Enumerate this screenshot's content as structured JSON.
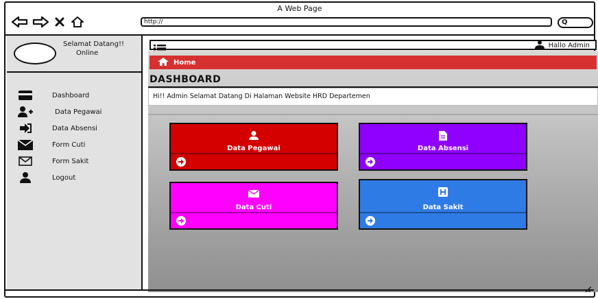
{
  "window": {
    "title": "A Web Page",
    "url": "http://",
    "search_label": "Q"
  },
  "sidebar": {
    "welcome": "Selamat Datang!!",
    "status": "Online",
    "menu": [
      {
        "label": "Dashboard",
        "icon": "credit-card-icon"
      },
      {
        "label": "Data Pegawai",
        "icon": "user-plus-icon"
      },
      {
        "label": "Data Absensi",
        "icon": "sign-in-icon"
      },
      {
        "label": "Form Cuti",
        "icon": "envelope-icon"
      },
      {
        "label": "Form Sakit",
        "icon": "envelope-outline-icon"
      },
      {
        "label": "Logout",
        "icon": "user-icon"
      }
    ]
  },
  "topbar": {
    "greeting": "Hallo Admin"
  },
  "breadcrumb": {
    "home": "Home"
  },
  "dashboard": {
    "title": "DASHBOARD",
    "message": "Hi!! Admin Selamat Datang Di Halaman Website HRD Departemen"
  },
  "cards": [
    {
      "label": "Data Pegawai",
      "icon": "user-icon",
      "color": "#d40000"
    },
    {
      "label": "Data Absensi",
      "icon": "file-icon",
      "color": "#8f00ff"
    },
    {
      "label": "Data Cuti",
      "icon": "envelope-icon",
      "color": "#ff00ff"
    },
    {
      "label": "Data Sakit",
      "icon": "hospital-icon",
      "color": "#2f7be6"
    }
  ],
  "colors": {
    "home_bar": "#d63030",
    "sidebar_bg": "#e2e2e2"
  }
}
